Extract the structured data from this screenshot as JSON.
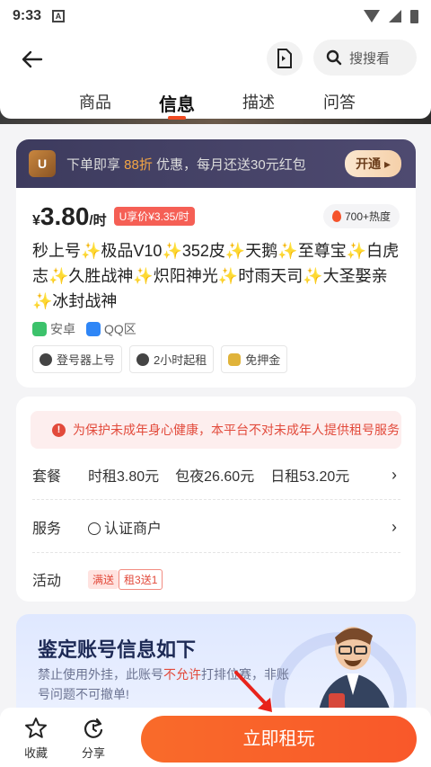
{
  "status_bar": {
    "time": "9:33",
    "app_badge": "A"
  },
  "header": {
    "search_placeholder": "搜搜看",
    "tabs": [
      {
        "label": "商品",
        "active": false
      },
      {
        "label": "信息",
        "active": true
      },
      {
        "label": "描述",
        "active": false
      },
      {
        "label": "问答",
        "active": false
      }
    ]
  },
  "vip_banner": {
    "badge": "U",
    "text_prefix": "下单即享 ",
    "discount": "88折",
    "text_suffix": " 优惠，每月还送30元红包",
    "button": "开通 ▸"
  },
  "price": {
    "currency": "¥",
    "value": "3.80",
    "unit": "/时",
    "vip_price": "U享价¥3.35/时",
    "heat": "700+热度"
  },
  "title": "秒上号✨极品V10✨352皮✨天鹅✨至尊宝✨白虎志✨久胜战神✨炽阳神光✨时雨天司✨大圣娶亲✨冰封战神",
  "platform_chips": [
    "安卓",
    "QQ区"
  ],
  "feature_tags": [
    "登号器上号",
    "2小时起租",
    "免押金"
  ],
  "warning": "为保护未成年身心健康，本平台不对未成年人提供租号服务",
  "rows": {
    "package": {
      "label": "套餐",
      "values": [
        "时租3.80元",
        "包夜26.60元",
        "日租53.20元"
      ]
    },
    "service": {
      "label": "服务",
      "value": "认证商户"
    },
    "activity": {
      "label": "活动",
      "tags": [
        "满送",
        "租3送1"
      ]
    }
  },
  "appraisal": {
    "title": "鉴定账号信息如下",
    "desc_prefix": "禁止使用外挂，此账号",
    "desc_red": "不允许",
    "desc_suffix": "打排位赛，非账号问题不可撤单!"
  },
  "bottom_bar": {
    "favorite": "收藏",
    "share": "分享",
    "rent_button": "立即租玩"
  },
  "colors": {
    "accent": "#f04a21",
    "warning": "#e24a3b",
    "vip_bar": "#3d3b5e"
  }
}
